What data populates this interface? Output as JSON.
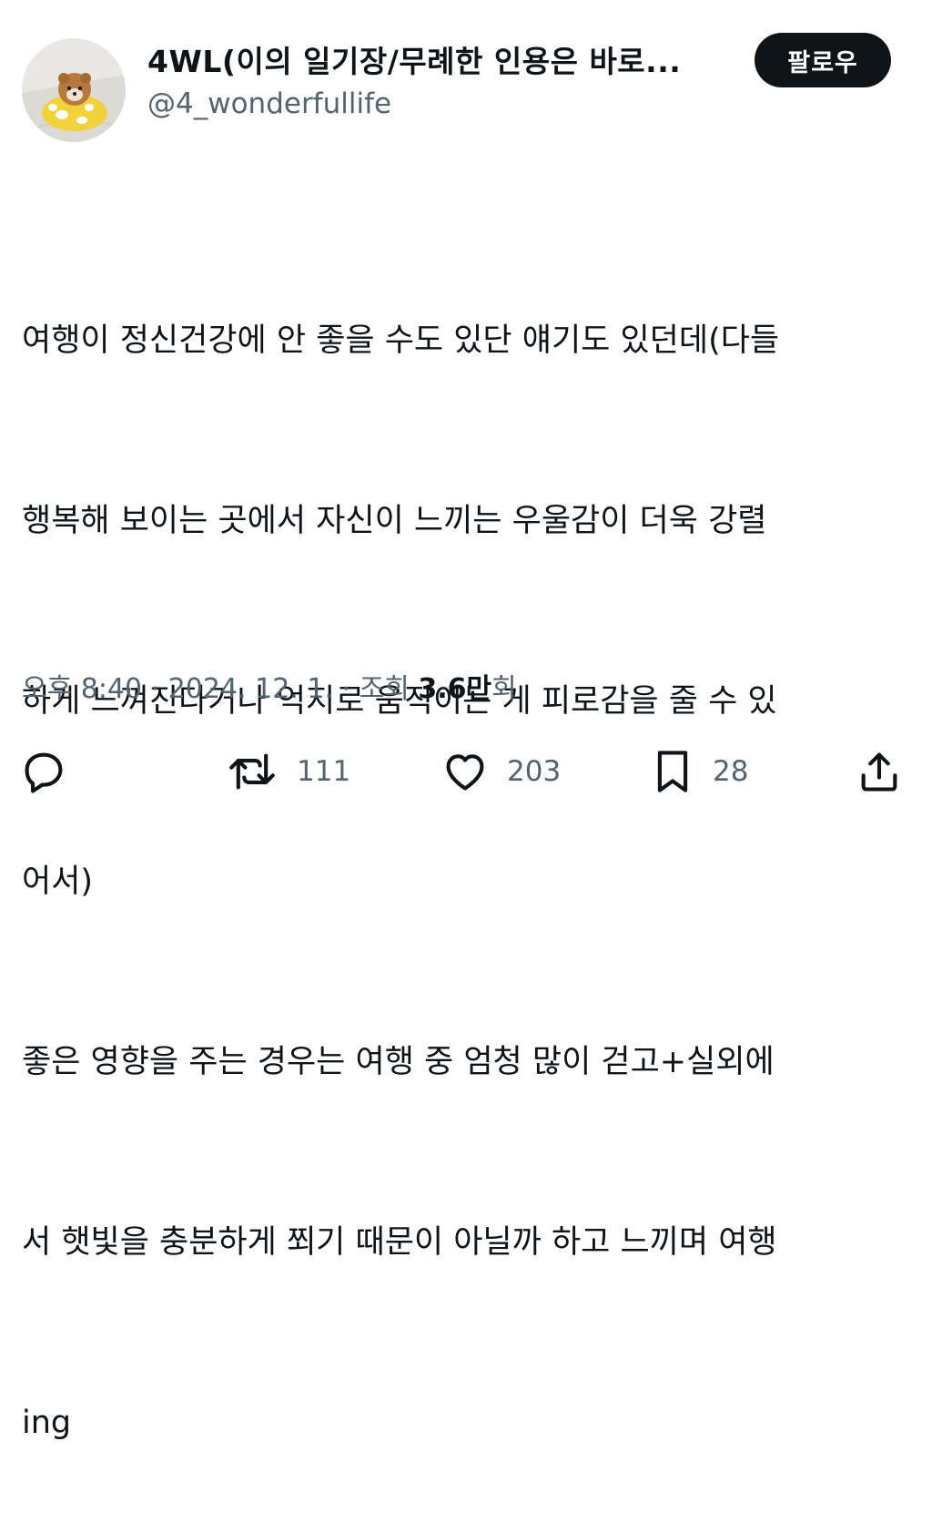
{
  "author": {
    "display_name": "4WL(이의 일기장/무례한 인용은 바로...",
    "handle": "@4_wonderfullife",
    "follow_label": "팔로우"
  },
  "tweet": {
    "lines": [
      "여행이 정신건강에 안 좋을 수도 있단 얘기도 있던데(다들",
      "행복해 보이는 곳에서 자신이 느끼는 우울감이 더욱 강렬",
      "하게 느껴진다거나 억지로 움직이는 게 피로감을 줄 수 있",
      "어서)",
      "좋은 영향을 주는 경우는 여행 중 엄청 많이 걷고+실외에",
      "서 햇빛을 충분하게 쬐기 때문이 아닐까 하고 느끼며 여행",
      "ing"
    ]
  },
  "meta": {
    "time": "오후 8:40",
    "separator": " · ",
    "date": "2024. 12. 1.",
    "views_label": "조회",
    "views_number": "3.6만",
    "views_suffix": "회"
  },
  "actions": {
    "reply_icon": "reply-bubble-icon",
    "retweet_icon": "retweet-icon",
    "retweet_count": "111",
    "like_icon": "heart-icon",
    "like_count": "203",
    "bookmark_icon": "bookmark-icon",
    "bookmark_count": "28",
    "share_icon": "share-icon"
  },
  "colors": {
    "text_primary": "#0f1419",
    "text_secondary": "#536471",
    "follow_bg": "#0f1419",
    "follow_text": "#ffffff"
  }
}
